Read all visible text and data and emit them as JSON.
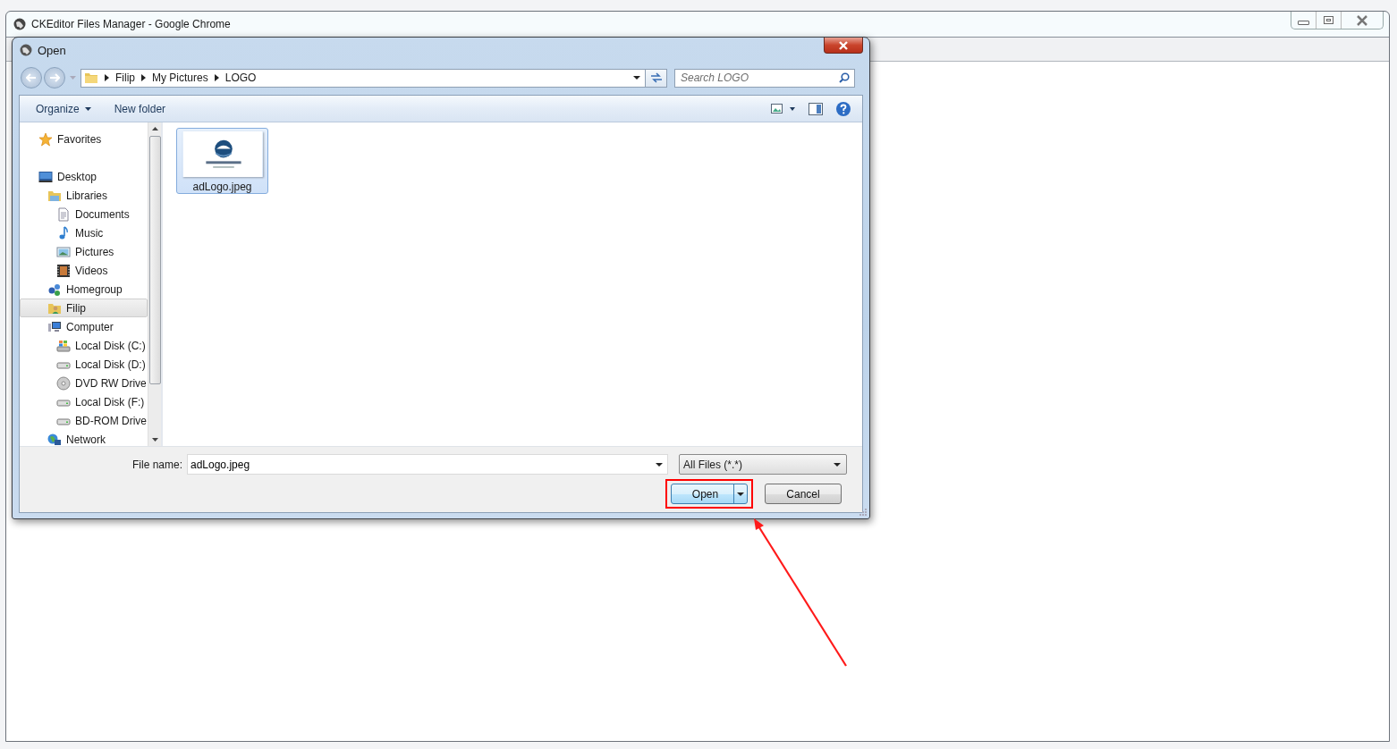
{
  "browser_window": {
    "title": "CKEditor Files Manager - Google Chrome"
  },
  "dialog": {
    "title": "Open",
    "breadcrumb": [
      "Filip",
      "My Pictures",
      "LOGO"
    ],
    "search": {
      "placeholder": "Search LOGO"
    },
    "toolbar": {
      "organize": "Organize",
      "new_folder": "New folder"
    },
    "navigation": [
      {
        "label": "Favorites",
        "kind": "star",
        "selected": false
      },
      {
        "label": "Desktop",
        "kind": "monitor",
        "selected": false,
        "children": [
          {
            "label": "Libraries",
            "kind": "library",
            "selected": false,
            "children": [
              {
                "label": "Documents",
                "kind": "document",
                "selected": false
              },
              {
                "label": "Music",
                "kind": "music",
                "selected": false
              },
              {
                "label": "Pictures",
                "kind": "pictures",
                "selected": false
              },
              {
                "label": "Videos",
                "kind": "film",
                "selected": false
              }
            ]
          },
          {
            "label": "Homegroup",
            "kind": "homegroup",
            "selected": false
          },
          {
            "label": "Filip",
            "kind": "user",
            "selected": true
          },
          {
            "label": "Computer",
            "kind": "computer",
            "selected": false,
            "children": [
              {
                "label": "Local Disk (C:)",
                "kind": "system-disk",
                "selected": false
              },
              {
                "label": "Local Disk (D:)",
                "kind": "disk",
                "selected": false
              },
              {
                "label": "DVD RW Drive",
                "kind": "dvd",
                "selected": false
              },
              {
                "label": "Local Disk (F:)",
                "kind": "disk",
                "selected": false
              },
              {
                "label": "BD-ROM Drive",
                "kind": "disk",
                "selected": false
              }
            ]
          },
          {
            "label": "Network",
            "kind": "network",
            "selected": false
          }
        ]
      }
    ],
    "files": [
      {
        "name": "adLogo.jpeg",
        "kind": "picture",
        "selected": true
      }
    ],
    "file_name": {
      "label": "File name:",
      "value": "adLogo.jpeg"
    },
    "file_type": {
      "value": "All Files (*.*)"
    },
    "buttons": [
      {
        "label": "Open",
        "kind": "split",
        "highlighted": true
      },
      {
        "label": "Cancel",
        "kind": "plain"
      }
    ]
  },
  "annotation_arrow": true
}
